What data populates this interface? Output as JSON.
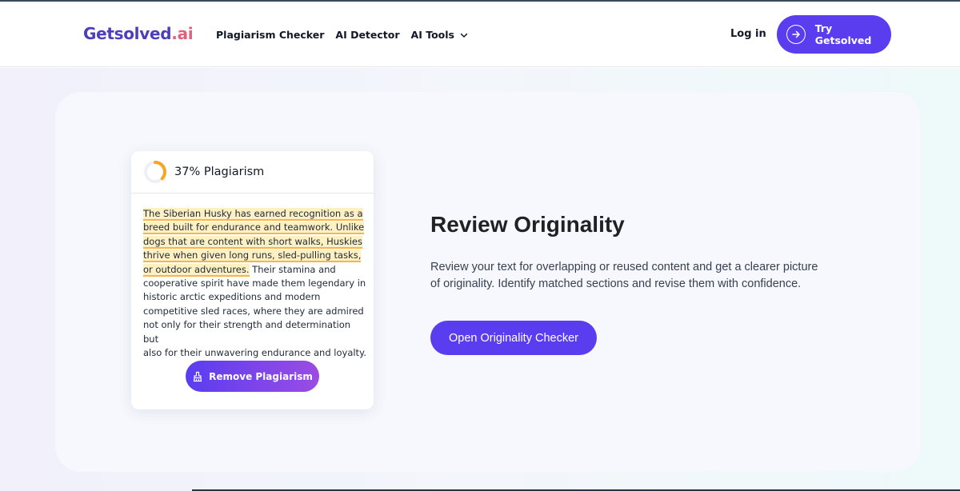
{
  "header": {
    "logo_part1": "Getsolved",
    "logo_part2": ".ai",
    "nav": [
      {
        "label": "Plagiarism Checker"
      },
      {
        "label": "AI Detector"
      },
      {
        "label": "AI Tools",
        "has_dropdown": true
      }
    ],
    "login_label": "Log in",
    "cta_label": "Try Getsolved",
    "cta_icon": "arrow-right-circle-icon"
  },
  "card": {
    "score_label": "37% Plagiarism",
    "score_fraction": 0.37,
    "highlighted_lines": [
      "The Siberian Husky has earned recognition as a",
      "breed built for endurance and teamwork. Unlike",
      "dogs that are content with short walks, Huskies",
      "thrive when given long runs, sled-pulling tasks,",
      "or outdoor adventures."
    ],
    "line5_rest": " Their stamina and",
    "plain_lines": [
      "cooperative spirit have made them legendary in",
      "historic arctic expeditions and modern",
      "competitive sled races, where they are admired",
      "not only for their strength and determination but",
      "also for their unwavering endurance and loyalty."
    ],
    "button_label": "Remove Plagiarism",
    "button_icon": "brush-icon"
  },
  "feature": {
    "title": "Review Originality",
    "description": "Review your text for overlapping or reused content and get a clearer picture of originality. Identify matched sections and revise them with confidence.",
    "button_label": "Open Originality Checker"
  },
  "colors": {
    "brand_purple": "#5b3df0",
    "logo_accent": "#e0627a",
    "highlight_fill": "#fdf0c2",
    "highlight_underline": "#f5b54a",
    "score_arc": "#f5a623"
  }
}
